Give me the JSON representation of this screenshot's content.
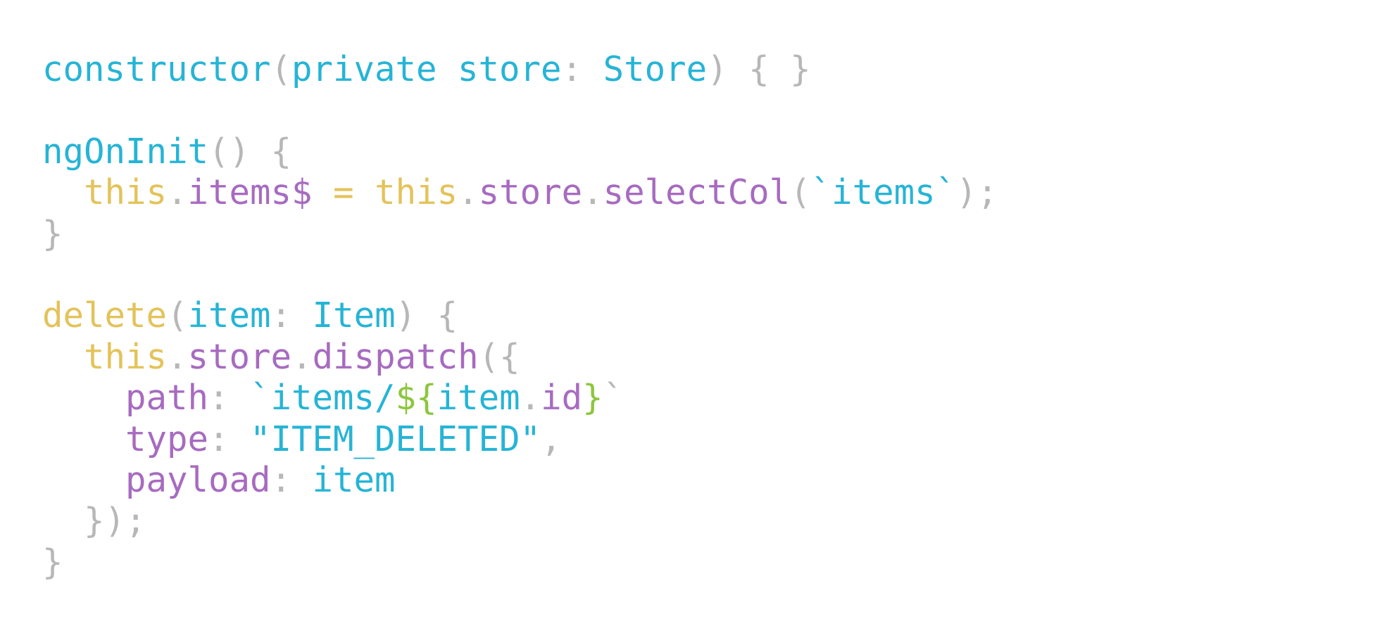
{
  "colors": {
    "background": "#ffffff",
    "punctuation": "#b7b7b7",
    "identifier": "#26b4d6",
    "keyword": "#e3c35a",
    "property": "#a76bc0",
    "interpolation": "#8dc63f"
  },
  "code": {
    "lines": [
      [
        {
          "t": "constructor",
          "c": "identifier"
        },
        {
          "t": "(",
          "c": "punctuation"
        },
        {
          "t": "private store",
          "c": "identifier"
        },
        {
          "t": ": ",
          "c": "punctuation"
        },
        {
          "t": "Store",
          "c": "identifier"
        },
        {
          "t": ") { }",
          "c": "punctuation"
        }
      ],
      [],
      [
        {
          "t": "ngOnInit",
          "c": "identifier"
        },
        {
          "t": "() {",
          "c": "punctuation"
        }
      ],
      [
        {
          "t": "  ",
          "c": "punctuation"
        },
        {
          "t": "this",
          "c": "keyword"
        },
        {
          "t": ".",
          "c": "punctuation"
        },
        {
          "t": "items$",
          "c": "property"
        },
        {
          "t": " = ",
          "c": "keyword"
        },
        {
          "t": "this",
          "c": "keyword"
        },
        {
          "t": ".",
          "c": "punctuation"
        },
        {
          "t": "store",
          "c": "property"
        },
        {
          "t": ".",
          "c": "punctuation"
        },
        {
          "t": "selectCol",
          "c": "property"
        },
        {
          "t": "(",
          "c": "punctuation"
        },
        {
          "t": "`items`",
          "c": "identifier"
        },
        {
          "t": ");",
          "c": "punctuation"
        }
      ],
      [
        {
          "t": "}",
          "c": "punctuation"
        }
      ],
      [],
      [
        {
          "t": "delete",
          "c": "keyword"
        },
        {
          "t": "(",
          "c": "punctuation"
        },
        {
          "t": "item",
          "c": "identifier"
        },
        {
          "t": ": ",
          "c": "punctuation"
        },
        {
          "t": "Item",
          "c": "identifier"
        },
        {
          "t": ") {",
          "c": "punctuation"
        }
      ],
      [
        {
          "t": "  ",
          "c": "punctuation"
        },
        {
          "t": "this",
          "c": "keyword"
        },
        {
          "t": ".",
          "c": "punctuation"
        },
        {
          "t": "store",
          "c": "property"
        },
        {
          "t": ".",
          "c": "punctuation"
        },
        {
          "t": "dispatch",
          "c": "property"
        },
        {
          "t": "({",
          "c": "punctuation"
        }
      ],
      [
        {
          "t": "    ",
          "c": "punctuation"
        },
        {
          "t": "path",
          "c": "property"
        },
        {
          "t": ": ",
          "c": "punctuation"
        },
        {
          "t": "`items/",
          "c": "identifier"
        },
        {
          "t": "${",
          "c": "interpolation"
        },
        {
          "t": "item",
          "c": "identifier"
        },
        {
          "t": ".",
          "c": "punctuation"
        },
        {
          "t": "id",
          "c": "property"
        },
        {
          "t": "}",
          "c": "interpolation"
        },
        {
          "t": "`",
          "c": "punctuation"
        }
      ],
      [
        {
          "t": "    ",
          "c": "punctuation"
        },
        {
          "t": "type",
          "c": "property"
        },
        {
          "t": ": ",
          "c": "punctuation"
        },
        {
          "t": "\"ITEM_DELETED\"",
          "c": "identifier"
        },
        {
          "t": ",",
          "c": "punctuation"
        }
      ],
      [
        {
          "t": "    ",
          "c": "punctuation"
        },
        {
          "t": "payload",
          "c": "property"
        },
        {
          "t": ": ",
          "c": "punctuation"
        },
        {
          "t": "item",
          "c": "identifier"
        }
      ],
      [
        {
          "t": "  });",
          "c": "punctuation"
        }
      ],
      [
        {
          "t": "}",
          "c": "punctuation"
        }
      ]
    ]
  }
}
